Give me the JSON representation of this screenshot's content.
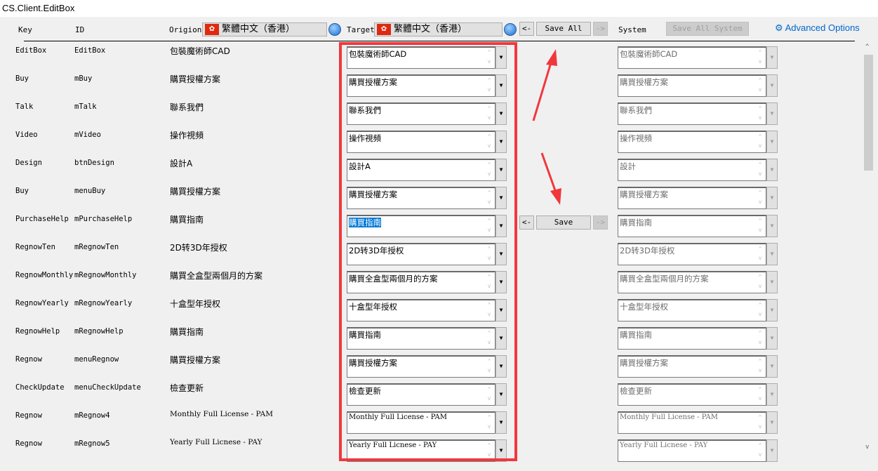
{
  "window": {
    "title": "CS.Client.EditBox"
  },
  "header": {
    "key_label": "Key",
    "id_label": "ID",
    "origin_label": "Origion",
    "origin_language": "繁體中文（香港）",
    "target_label": "Target",
    "target_language": "繁體中文（香港）",
    "copy_left": "<-",
    "save_all": "Save All",
    "copy_right": "->",
    "system_label": "System",
    "save_all_system": "Save All System",
    "advanced_options": "Advanced Options"
  },
  "row_actions": {
    "copy_left": "<-",
    "save": "Save",
    "copy_right": "->",
    "selected_row": 6
  },
  "rows": [
    {
      "key": "EditBox",
      "id": "EditBox",
      "origin": "包裝魔術師CAD",
      "target": "包裝魔術師CAD",
      "system": "包裝魔術師CAD"
    },
    {
      "key": "Buy",
      "id": "mBuy",
      "origin": "購買授權方案",
      "target": "購買授權方案",
      "system": "購買授權方案"
    },
    {
      "key": "Talk",
      "id": "mTalk",
      "origin": "聯系我們",
      "target": "聯系我們",
      "system": "聯系我們"
    },
    {
      "key": "Video",
      "id": "mVideo",
      "origin": "操作視頻",
      "target": "操作視頻",
      "system": "操作視頻"
    },
    {
      "key": "Design",
      "id": "btnDesign",
      "origin": "設計A",
      "target": "設計A",
      "system": "設計"
    },
    {
      "key": "Buy",
      "id": "menuBuy",
      "origin": "購買授權方案",
      "target": "購買授權方案",
      "system": "購買授權方案"
    },
    {
      "key": "PurchaseHelp",
      "id": "mPurchaseHelp",
      "origin": "購買指南",
      "target": "購買指南",
      "system": "購買指南"
    },
    {
      "key": "RegnowTen",
      "id": "mRegnowTen",
      "origin": "2D转3D年授权",
      "target": "2D转3D年授权",
      "system": "2D转3D年授权"
    },
    {
      "key": "RegnowMonthly",
      "id": "mRegnowMonthly",
      "origin": "購買全盒型兩個月的方案",
      "target": "購買全盒型兩個月的方案",
      "system": "購買全盒型兩個月的方案"
    },
    {
      "key": "RegnowYearly",
      "id": "mRegnowYearly",
      "origin": "十盒型年授权",
      "target": "十盒型年授权",
      "system": "十盒型年授权"
    },
    {
      "key": "RegnowHelp",
      "id": "mRegnowHelp",
      "origin": "購買指南",
      "target": "購買指南",
      "system": "購買指南"
    },
    {
      "key": "Regnow",
      "id": "menuRegnow",
      "origin": "購買授權方案",
      "target": "購買授權方案",
      "system": "購買授權方案"
    },
    {
      "key": "CheckUpdate",
      "id": "menuCheckUpdate",
      "origin": "檢查更新",
      "target": "檢查更新",
      "system": "檢查更新"
    },
    {
      "key": "Regnow",
      "id": "mRegnow4",
      "origin": "Monthly Full License - PAM",
      "target": "Monthly Full License - PAM",
      "system": "Monthly Full License - PAM"
    },
    {
      "key": "Regnow",
      "id": "mRegnow5",
      "origin": "Yearly Full Licnese - PAY",
      "target": "Yearly Full Licnese - PAY",
      "system": "Yearly Full Licnese - PAY"
    }
  ],
  "colors": {
    "highlight": "#f0383c",
    "link": "#0066cc",
    "selection": "#0078d7"
  }
}
